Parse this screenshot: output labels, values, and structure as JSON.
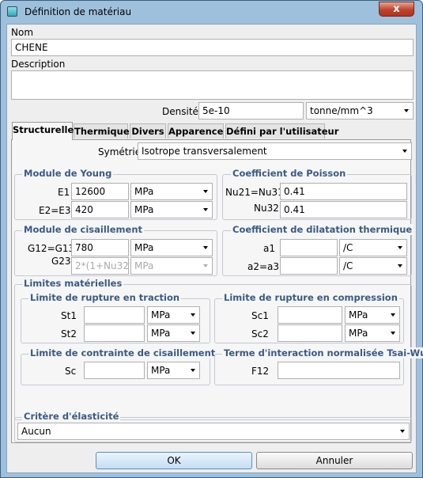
{
  "window": {
    "title": "Définition de matériau",
    "close_symbol": "x"
  },
  "nom": {
    "label": "Nom",
    "value": "CHENE"
  },
  "description": {
    "label": "Description",
    "value": ""
  },
  "densite": {
    "label": "Densité",
    "value": "5e-10",
    "unit": "tonne/mm^3"
  },
  "tabs": [
    {
      "label": "Structurelle",
      "active": true
    },
    {
      "label": "Thermique",
      "active": false
    },
    {
      "label": "Divers",
      "active": false
    },
    {
      "label": "Apparence",
      "active": false
    },
    {
      "label": "Défini par l'utilisateur",
      "active": false
    }
  ],
  "symetrie": {
    "label": "Symétrie",
    "value": "Isotrope transversalement"
  },
  "young": {
    "title": "Module de Young",
    "rows": [
      {
        "label": "E1",
        "value": "12600",
        "unit": "MPa"
      },
      {
        "label": "E2=E3",
        "value": "420",
        "unit": "MPa"
      }
    ]
  },
  "poisson": {
    "title": "Coefficient de Poisson",
    "rows": [
      {
        "label": "Nu21=Nu31",
        "value": "0.41"
      },
      {
        "label": "Nu32",
        "value": "0.41"
      }
    ]
  },
  "cisaillement": {
    "title": "Module de cisaillement",
    "rows": [
      {
        "label": "G12=G13",
        "value": "780",
        "unit": "MPa"
      },
      {
        "label": "G23",
        "value": "2*(1+Nu32)]",
        "unit": "MPa",
        "disabled": true
      }
    ]
  },
  "dilatation": {
    "title": "Coefficient de dilatation thermique",
    "rows": [
      {
        "label": "a1",
        "value": "",
        "unit": "/C"
      },
      {
        "label": "a2=a3",
        "value": "",
        "unit": "/C"
      }
    ]
  },
  "limites": {
    "title": "Limites matérielles",
    "traction": {
      "title": "Limite de rupture en traction",
      "rows": [
        {
          "label": "St1",
          "value": "",
          "unit": "MPa"
        },
        {
          "label": "St2",
          "value": "",
          "unit": "MPa"
        }
      ]
    },
    "compression": {
      "title": "Limite de rupture en compression",
      "rows": [
        {
          "label": "Sc1",
          "value": "",
          "unit": "MPa"
        },
        {
          "label": "Sc2",
          "value": "",
          "unit": "MPa"
        }
      ]
    },
    "cisaillement": {
      "title": "Limite de contrainte de cisaillement",
      "rows": [
        {
          "label": "Sc",
          "value": "",
          "unit": "MPa"
        }
      ]
    },
    "tsai_wu": {
      "title": "Terme d'interaction normalisée Tsai-Wu",
      "rows": [
        {
          "label": "F12",
          "value": ""
        }
      ]
    }
  },
  "critere": {
    "title": "Critère d'élasticité",
    "value": "Aucun"
  },
  "buttons": {
    "ok": "OK",
    "cancel": "Annuler"
  }
}
